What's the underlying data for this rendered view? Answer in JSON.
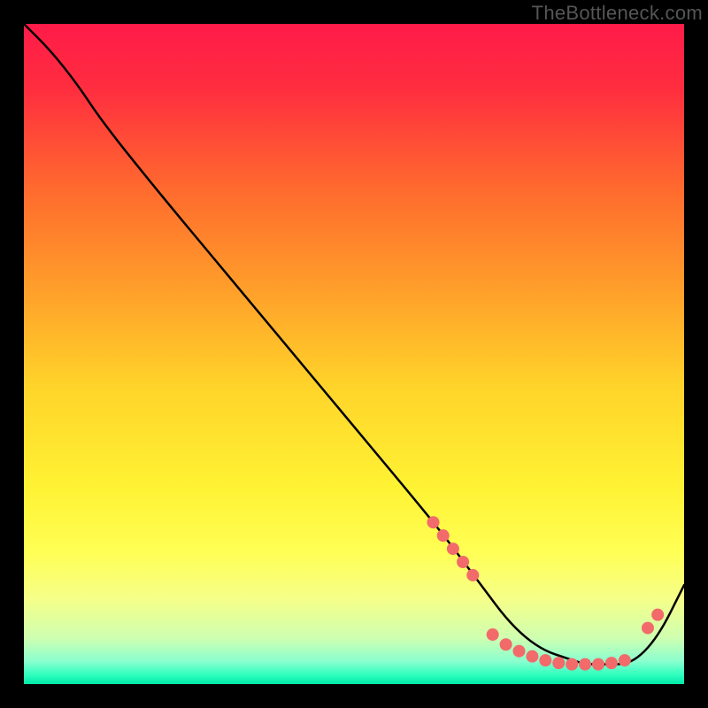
{
  "watermark": "TheBottleneck.com",
  "colors": {
    "gradient_stops": [
      {
        "offset": 0.0,
        "color": "#ff1b49"
      },
      {
        "offset": 0.1,
        "color": "#ff2e3f"
      },
      {
        "offset": 0.25,
        "color": "#ff6a2e"
      },
      {
        "offset": 0.4,
        "color": "#ff9e2a"
      },
      {
        "offset": 0.55,
        "color": "#ffd42a"
      },
      {
        "offset": 0.7,
        "color": "#fff233"
      },
      {
        "offset": 0.8,
        "color": "#ffff55"
      },
      {
        "offset": 0.87,
        "color": "#f6ff88"
      },
      {
        "offset": 0.93,
        "color": "#cfffb0"
      },
      {
        "offset": 0.965,
        "color": "#8bffcf"
      },
      {
        "offset": 0.985,
        "color": "#33ffbf"
      },
      {
        "offset": 1.0,
        "color": "#00e9a8"
      }
    ],
    "curve": "#000000",
    "marker": "#f26a6a",
    "frame": "#000000"
  },
  "chart_data": {
    "type": "line",
    "title": "",
    "xlabel": "",
    "ylabel": "",
    "xlim": [
      0,
      100
    ],
    "ylim": [
      0,
      100
    ],
    "grid": false,
    "legend": false,
    "series": [
      {
        "name": "curve",
        "x": [
          0,
          4,
          8,
          12,
          20,
          30,
          40,
          50,
          60,
          64,
          67,
          70,
          73,
          76,
          79,
          82,
          85,
          88,
          91,
          93,
          95,
          97,
          99,
          100
        ],
        "y": [
          100,
          96,
          91,
          85,
          75,
          63,
          51,
          39,
          27,
          22,
          18,
          14,
          10,
          7,
          5,
          4,
          3,
          3,
          3,
          4,
          6,
          9,
          13,
          15
        ]
      }
    ],
    "markers": [
      {
        "x": 62.0,
        "y": 24.5
      },
      {
        "x": 63.5,
        "y": 22.5
      },
      {
        "x": 65.0,
        "y": 20.5
      },
      {
        "x": 66.5,
        "y": 18.5
      },
      {
        "x": 68.0,
        "y": 16.5
      },
      {
        "x": 71.0,
        "y": 7.5
      },
      {
        "x": 73.0,
        "y": 6.0
      },
      {
        "x": 75.0,
        "y": 5.0
      },
      {
        "x": 77.0,
        "y": 4.2
      },
      {
        "x": 79.0,
        "y": 3.6
      },
      {
        "x": 81.0,
        "y": 3.2
      },
      {
        "x": 83.0,
        "y": 3.0
      },
      {
        "x": 85.0,
        "y": 3.0
      },
      {
        "x": 87.0,
        "y": 3.0
      },
      {
        "x": 89.0,
        "y": 3.2
      },
      {
        "x": 91.0,
        "y": 3.6
      },
      {
        "x": 94.5,
        "y": 8.5
      },
      {
        "x": 96.0,
        "y": 10.5
      }
    ]
  }
}
